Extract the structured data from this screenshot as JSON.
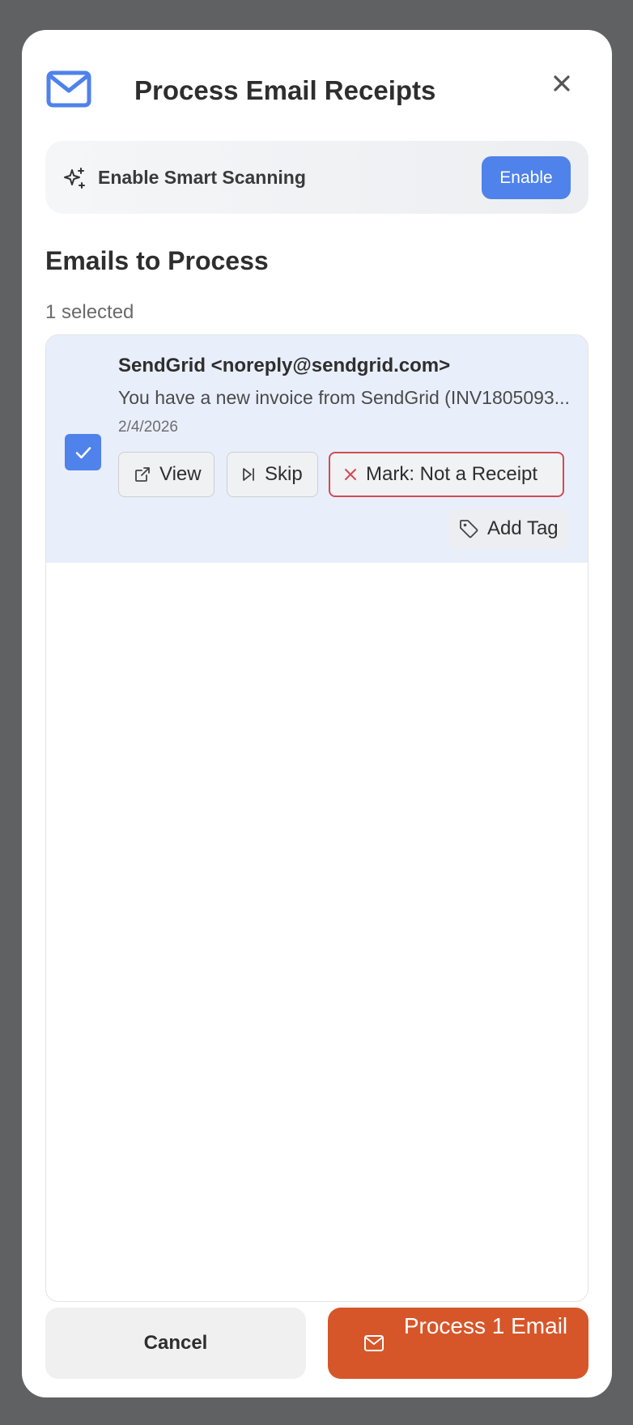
{
  "modal": {
    "title": "Process Email Receipts",
    "close_label": "×"
  },
  "banner": {
    "label": "Enable Smart Scanning",
    "button_label": "Enable"
  },
  "section": {
    "title": "Emails to Process",
    "selected_count": "1 selected"
  },
  "emails": [
    {
      "checked": true,
      "sender": "SendGrid <noreply@sendgrid.com>",
      "subject": "You have a new invoice from SendGrid (INV1805093...",
      "date": "2/4/2026",
      "actions": {
        "view": "View",
        "skip": "Skip",
        "not_receipt": "Mark: Not a Receipt",
        "add_tag": "Add Tag"
      }
    }
  ],
  "footer": {
    "cancel_label": "Cancel",
    "process_label": "Process 1 Email"
  },
  "colors": {
    "accent_blue": "#4f82ea",
    "process_orange": "#d6562a",
    "danger_red": "#d14a55",
    "row_selected_bg": "#e9eefb"
  }
}
